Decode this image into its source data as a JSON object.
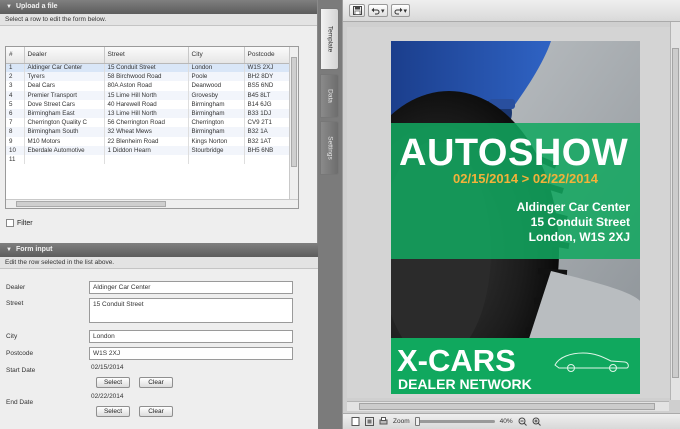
{
  "upload_panel": {
    "title": "Upload a file",
    "instruction": "Select a row to edit the form below.",
    "columns": [
      "#",
      "Dealer",
      "Street",
      "City",
      "Postcode"
    ],
    "rows": [
      [
        "1",
        "Aldinger Car Center",
        "15 Conduit Street",
        "London",
        "W1S 2XJ"
      ],
      [
        "2",
        "Tyrers",
        "58 Birchwood Road",
        "Poole",
        "BH2 8DY"
      ],
      [
        "3",
        "Deal Cars",
        "80A Aston Road",
        "Deanwood",
        "BS5 6ND"
      ],
      [
        "4",
        "Premier Transport",
        "15 Lime Hill North",
        "Grovesby",
        "B45 8LT"
      ],
      [
        "5",
        "Dove Street Cars",
        "40 Harewell Road",
        "Birmingham",
        "B14 6JG"
      ],
      [
        "6",
        "Birmingham East",
        "13 Lime Hill North",
        "Birmingham",
        "B33 1DJ"
      ],
      [
        "7",
        "Cherrington Quality C",
        "56 Cherrington Road",
        "Cherrington",
        "CV9 2T1"
      ],
      [
        "8",
        "Birmingham South",
        "32 Wheat Mews",
        "Birmingham",
        "B32 1A"
      ],
      [
        "9",
        "M10 Motors",
        "22 Blenheim Road",
        "Kings Norton",
        "B32 1AT"
      ],
      [
        "10",
        "Eberdale Automotive",
        "1 Diddon Hearn",
        "Stourbridge",
        "BH5 6NB"
      ],
      [
        "11",
        "",
        "",
        "",
        ""
      ]
    ],
    "filter_label": "Filter"
  },
  "form_panel": {
    "title": "Form input",
    "instruction": "Edit the row selected in the list above.",
    "fields": {
      "dealer_label": "Dealer",
      "dealer_value": "Aldinger Car Center",
      "street_label": "Street",
      "street_value": "15 Conduit Street",
      "city_label": "City",
      "city_value": "London",
      "postcode_label": "Postcode",
      "postcode_value": "W1S 2XJ",
      "start_label": "Start Date",
      "start_value": "02/15/2014",
      "end_label": "End Date",
      "end_value": "02/22/2014"
    },
    "select_label": "Select",
    "clear_label": "Clear"
  },
  "side_tabs": [
    "Template",
    "Data",
    "Settings"
  ],
  "toolbar": {
    "save_icon": "save-icon",
    "undo_icon": "undo-icon",
    "redo_icon": "redo-icon",
    "dropdown_glyph": "▾"
  },
  "poster": {
    "title": "AUTOSHOW",
    "dates": "02/15/2014 > 02/22/2014",
    "address_line1": "Aldinger Car Center",
    "address_line2": "15 Conduit Street",
    "address_line3": "London, W1S 2XJ",
    "brand": "X-CARS",
    "tagline": "DEALER NETWORK",
    "colors": {
      "green": "#10a85e",
      "orange": "#f3b23a"
    }
  },
  "status_bar": {
    "zoom_label": "Zoom",
    "zoom_value": "40%"
  }
}
